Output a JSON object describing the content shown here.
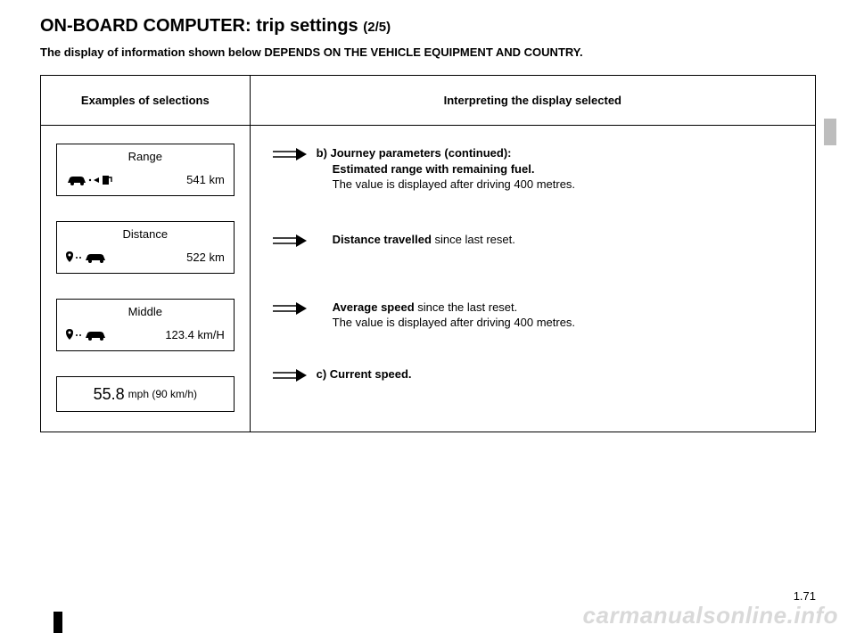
{
  "title_main": "ON-BOARD COMPUTER: trip settings",
  "title_sub": "(2/5)",
  "subtitle": "The display of information shown below DEPENDS ON THE VEHICLE EQUIPMENT AND COUNTRY.",
  "headers": {
    "left": "Examples of selections",
    "right": "Interpreting the display selected"
  },
  "selections": [
    {
      "label": "Range",
      "value": "541 km",
      "icon": "car-fuel"
    },
    {
      "label": "Distance",
      "value": "522 km",
      "icon": "pin-car"
    },
    {
      "label": "Middle",
      "value": "123.4 km/H",
      "icon": "pin-car"
    },
    {
      "speed_big": "55.8",
      "speed_small": "mph (90 km/h)"
    }
  ],
  "interpret": [
    {
      "heading": "b) Journey parameters (continued):",
      "bold": "Estimated range with remaining fuel.",
      "normal": "The value is displayed after driving 400 metres.",
      "indent": true
    },
    {
      "bold": "Distance travelled ",
      "normal": "since last reset.",
      "inline": true,
      "indent": true
    },
    {
      "bold": "Average speed ",
      "normal_inline": "since the last reset.",
      "normal2": "The value is displayed after driving 400 metres.",
      "indent": true
    },
    {
      "heading": "c) Current speed."
    }
  ],
  "page_number": "1.71",
  "watermark": "carmanualsonline.info"
}
